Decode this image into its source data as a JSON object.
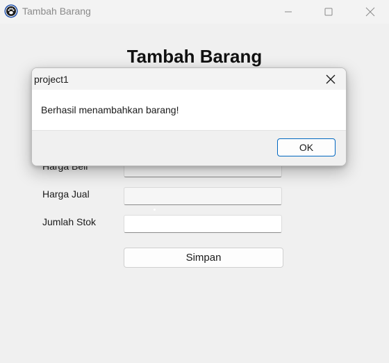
{
  "window": {
    "title": "Tambah Barang",
    "icon": "paw-icon"
  },
  "form": {
    "heading": "Tambah Barang",
    "fields": [
      {
        "label": "Harga Beli",
        "value": ""
      },
      {
        "label": "Harga Jual",
        "value": ""
      },
      {
        "label": "Jumlah Stok",
        "value": ""
      }
    ],
    "submit_label": "Simpan"
  },
  "dialog": {
    "title": "project1",
    "message": "Berhasil menambahkan barang!",
    "ok_label": "OK",
    "accent_color": "#0067c0"
  }
}
